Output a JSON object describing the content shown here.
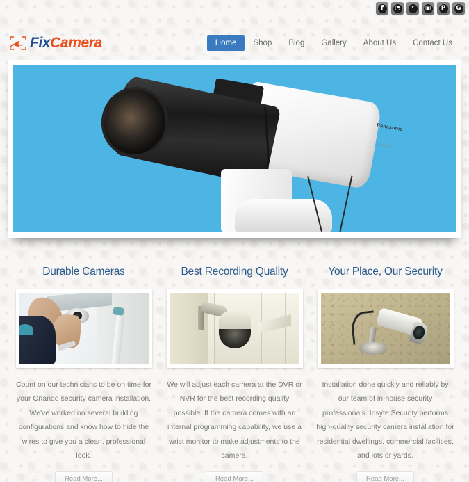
{
  "site": {
    "logo_fix": "Fix",
    "logo_camera": "Camera"
  },
  "social": {
    "items": [
      {
        "name": "facebook-icon",
        "glyph": "f",
        "label": "Facebook"
      },
      {
        "name": "rss-icon",
        "glyph": "◔",
        "label": "RSS"
      },
      {
        "name": "twitter-icon",
        "glyph": "ᵛ",
        "label": "Twitter"
      },
      {
        "name": "flickr-icon",
        "glyph": "▣",
        "label": "Flickr"
      },
      {
        "name": "pinterest-icon",
        "glyph": "P",
        "label": "Pinterest"
      },
      {
        "name": "google-plus-icon",
        "glyph": "G",
        "label": "Google Plus"
      }
    ]
  },
  "nav": {
    "items": [
      {
        "label": "Home",
        "active": true
      },
      {
        "label": "Shop",
        "active": false
      },
      {
        "label": "Blog",
        "active": false
      },
      {
        "label": "Gallery",
        "active": false
      },
      {
        "label": "About Us",
        "active": false
      },
      {
        "label": "Contact Us",
        "active": false
      }
    ]
  },
  "hero": {
    "camera_brand": "Panasonic",
    "camera_model": "WV-CP314",
    "background_color": "#4db5e4"
  },
  "features": [
    {
      "title": "Durable Cameras",
      "image_alt": "technician-installing-dome-camera",
      "text": "Count on our technicians to be on time for your Orlando security camera installation. We've worked on several building configurations and know how to hide the wires to give you a clean, professional look.",
      "button": "Read More..."
    },
    {
      "title": "Best Recording Quality",
      "image_alt": "ceiling-mounted-dome-camera",
      "text": "We will adjust each camera at the DVR or NVR for the best recording quality possible. If the camera comes with an internal programming capability, we use a wrist monitor to make adjustments to the camera.",
      "button": "Read More..."
    },
    {
      "title": "Your Place, Our Security",
      "image_alt": "outdoor-bullet-camera-on-wall",
      "text": "Installation done quickly and reliably by our team of in-house security professionals. Insyte Security performs high-quality security camera installation for residential dwellings, commercial facilities, and lots or yards.",
      "button": "Read More..."
    }
  ],
  "colors": {
    "accent_blue": "#3a7ac0",
    "heading_blue": "#2d5b8e",
    "logo_orange": "#e8501d",
    "logo_blue": "#1f4e96",
    "body_bg": "#f8f7f5"
  }
}
